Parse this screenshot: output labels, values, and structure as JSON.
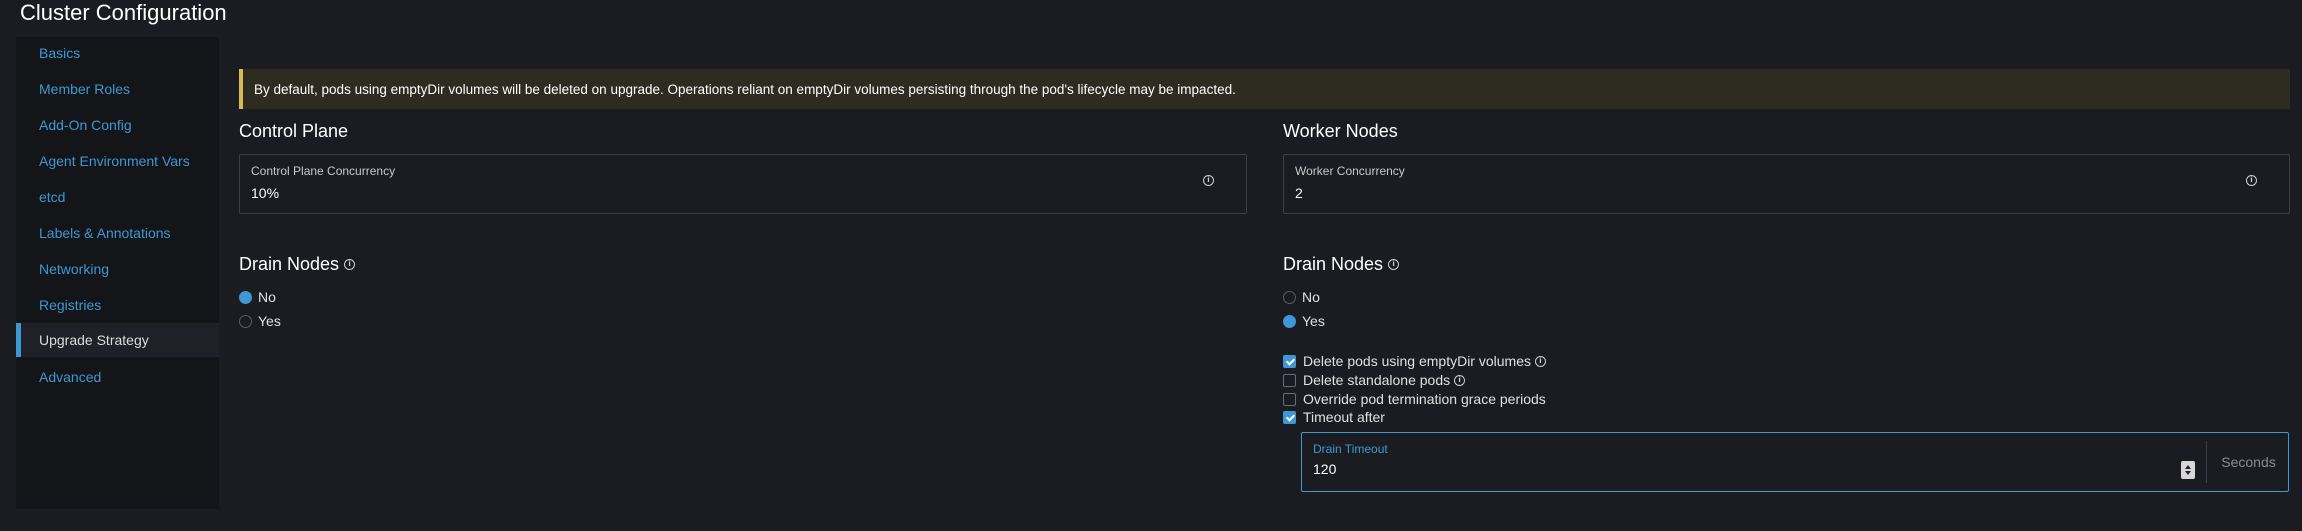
{
  "page": {
    "title": "Cluster Configuration"
  },
  "sidebar": {
    "items": [
      {
        "label": "Basics"
      },
      {
        "label": "Member Roles"
      },
      {
        "label": "Add-On Config"
      },
      {
        "label": "Agent Environment Vars"
      },
      {
        "label": "etcd"
      },
      {
        "label": "Labels & Annotations"
      },
      {
        "label": "Networking"
      },
      {
        "label": "Registries"
      },
      {
        "label": "Upgrade Strategy"
      },
      {
        "label": "Advanced"
      }
    ],
    "active": "Upgrade Strategy"
  },
  "banner": {
    "text": "By default, pods using emptyDir volumes will be deleted on upgrade. Operations reliant on emptyDir volumes persisting through the pod's lifecycle may be impacted."
  },
  "control_plane": {
    "title": "Control Plane",
    "concurrency_label": "Control Plane Concurrency",
    "concurrency_value": "10%",
    "drain": {
      "title": "Drain Nodes",
      "options": [
        "No",
        "Yes"
      ],
      "selected": "No"
    }
  },
  "worker": {
    "title": "Worker Nodes",
    "concurrency_label": "Worker Concurrency",
    "concurrency_value": "2",
    "drain": {
      "title": "Drain Nodes",
      "options": [
        "No",
        "Yes"
      ],
      "selected": "Yes",
      "checkboxes": [
        {
          "label": "Delete pods using emptyDir volumes",
          "checked": true
        },
        {
          "label": "Delete standalone pods",
          "checked": false
        },
        {
          "label": "Override pod termination grace periods",
          "checked": false
        },
        {
          "label": "Timeout after",
          "checked": true
        }
      ],
      "timeout": {
        "label": "Drain Timeout",
        "value": "120",
        "unit": "Seconds"
      }
    }
  },
  "colors": {
    "accent": "#3d98d3",
    "warning_border": "#d4bd57",
    "background": "#1b1c21"
  },
  "icons": {
    "info": "info-circle-icon",
    "stepper": "number-stepper-icon"
  }
}
